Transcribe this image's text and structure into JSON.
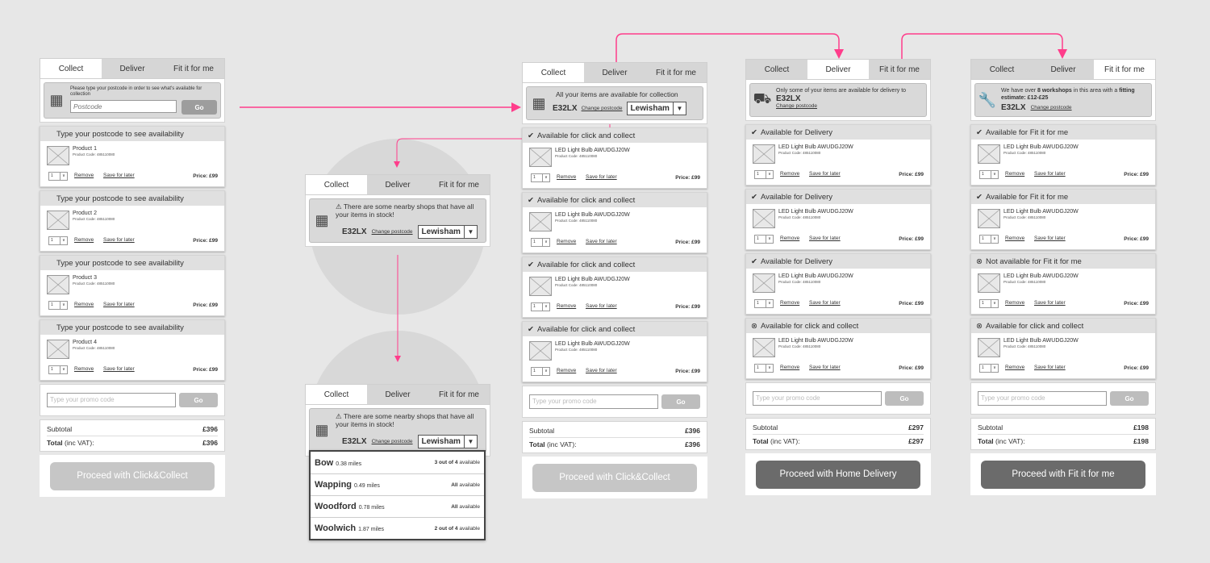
{
  "tabs": [
    "Collect",
    "Deliver",
    "Fit it for me"
  ],
  "accent": "#ff3d8b",
  "p1": {
    "hint": "Please type your postcode in order to see what's available for collection",
    "placeholder": "Postcode",
    "go": "Go",
    "items": [
      {
        "status": "Type your postcode to see availability",
        "name": "Product 1",
        "code": "Product Code: 485110080"
      },
      {
        "status": "Type your postcode to see availability",
        "name": "Product 2",
        "code": "Product Code: 485110080"
      },
      {
        "status": "Type your postcode to see availability",
        "name": "Product 3",
        "code": "Product Code: 485110080"
      },
      {
        "status": "Type your postcode to see availability",
        "name": "Product 4",
        "code": "Product Code: 485110080"
      }
    ],
    "subtotal": "£396",
    "total": "£396",
    "proceed": "Proceed with Click&Collect"
  },
  "common": {
    "qty": "1",
    "remove": "Remove",
    "save": "Save for later",
    "price": "Price: £99",
    "promo": "Type your promo code",
    "go": "Go",
    "subtotal_label": "Subtotal",
    "total_label": "Total (inc VAT):",
    "total_label_b": "Total",
    "total_label_rest": " (inc VAT):",
    "product": "LED Light Bulb AWUDGJ20W",
    "code": "Product Code: 485110080"
  },
  "mini": {
    "warning": "There are some nearby shops that have all your items in stock!",
    "postcode": "E32LX",
    "change": "Change postcode",
    "store": "Lewisham"
  },
  "stores": [
    {
      "name": "Bow",
      "dist": "0.38 miles",
      "avail_b": "3 out of 4",
      "avail": "available"
    },
    {
      "name": "Wapping",
      "dist": "0.49 miles",
      "avail_b": "All",
      "avail": "available"
    },
    {
      "name": "Woodford",
      "dist": "0.78 miles",
      "avail_b": "All",
      "avail": "available"
    },
    {
      "name": "Woolwich",
      "dist": "1.87 miles",
      "avail_b": "2 out of 4",
      "avail": "available"
    }
  ],
  "p3": {
    "msg": "All your items are available for collection",
    "postcode": "E32LX",
    "change": "Change postcode",
    "store": "Lewisham",
    "statuses": [
      "Available for click and collect",
      "Available for click and collect",
      "Available for click and collect",
      "Available for click and collect"
    ],
    "subtotal": "£396",
    "total": "£396",
    "proceed": "Proceed with Click&Collect"
  },
  "p4": {
    "msg": "Only some of your items are available for delivery to",
    "postcode": "E32LX",
    "change": "Change postcode",
    "statuses": [
      "Available for Delivery",
      "Available for Delivery",
      "Available for Delivery",
      "Available for click and collect"
    ],
    "subtotal": "£297",
    "total": "£297",
    "proceed": "Proceed with Home Delivery"
  },
  "p5": {
    "msg_a": "We have over ",
    "msg_b": "8 workshops",
    "msg_c": " in this area with a ",
    "msg_d": "fitting estimate: £12-£25",
    "postcode": "E32LX",
    "change": "Change postcode",
    "statuses": [
      "Available for Fit it for me",
      "Available for Fit it for me",
      "Not available for Fit it for me",
      "Available for click and collect"
    ],
    "subtotal": "£198",
    "total": "£198",
    "proceed": "Proceed with Fit it for me"
  }
}
